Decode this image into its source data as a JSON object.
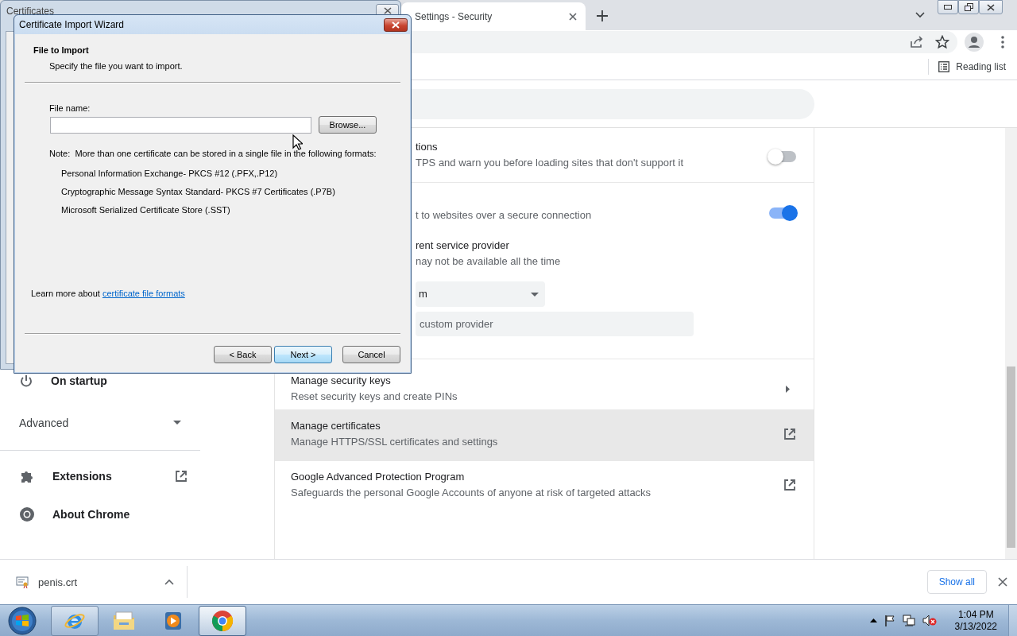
{
  "certificates_window": {
    "title": "Certificates"
  },
  "wizard": {
    "title": "Certificate Import Wizard",
    "heading": "File to Import",
    "subheading": "Specify the file you want to import.",
    "file_name_label": "File name:",
    "browse_button": "Browse...",
    "note": "Note:  More than one certificate can be stored in a single file in the following formats:",
    "formats": [
      "Personal Information Exchange- PKCS #12 (.PFX,.P12)",
      "Cryptographic Message Syntax Standard- PKCS #7 Certificates (.P7B)",
      "Microsoft Serialized Certificate Store (.SST)"
    ],
    "learn_more": "Learn more about ",
    "learn_more_link": "certificate file formats",
    "buttons": [
      {
        "label": "< Back",
        "default": false
      },
      {
        "label": "Next >",
        "default": true
      },
      {
        "label": "Cancel",
        "default": false
      }
    ]
  },
  "browser": {
    "tabs": [
      {
        "title": "Settings - Security",
        "selected": true
      }
    ],
    "reading_list": "Reading list"
  },
  "sidebar": {
    "items": [
      {
        "kind": "item",
        "label": "On startup"
      },
      {
        "kind": "section",
        "label": "Advanced",
        "expanded": false
      },
      {
        "kind": "external",
        "label": "Extensions"
      },
      {
        "kind": "item",
        "label": "About Chrome"
      }
    ]
  },
  "security": {
    "rows": [
      {
        "kind": "toggle",
        "title": "tions",
        "description": "TPS and warn you before loading sites that don't support it",
        "on": false
      },
      {
        "kind": "secure_dns",
        "description": "t to websites over a secure connection",
        "on": true,
        "option_title": "rent service provider",
        "option_description": "nay not be available all the time",
        "dropdown_value": "m",
        "custom_placeholder": "custom provider"
      },
      {
        "kind": "subpage",
        "title": "Manage security keys",
        "description": "Reset security keys and create PINs",
        "highlighted": false
      },
      {
        "kind": "external",
        "title": "Manage certificates",
        "description": "Manage HTTPS/SSL certificates and settings",
        "highlighted": true
      },
      {
        "kind": "external",
        "title": "Google Advanced Protection Program",
        "description": "Safeguards the personal Google Accounts of anyone at risk of targeted attacks",
        "highlighted": false
      }
    ]
  },
  "downloads": {
    "items": [
      {
        "name": "penis.crt"
      }
    ],
    "show_all": "Show all"
  },
  "taskbar": {
    "apps": [
      {
        "kind": "ie",
        "running": true,
        "selected": false
      },
      {
        "kind": "explorer",
        "running": false,
        "selected": false
      },
      {
        "kind": "media",
        "running": false,
        "selected": false
      },
      {
        "kind": "chrome",
        "running": true,
        "selected": true
      }
    ],
    "time": "1:04 PM",
    "date": "3/13/2022"
  }
}
